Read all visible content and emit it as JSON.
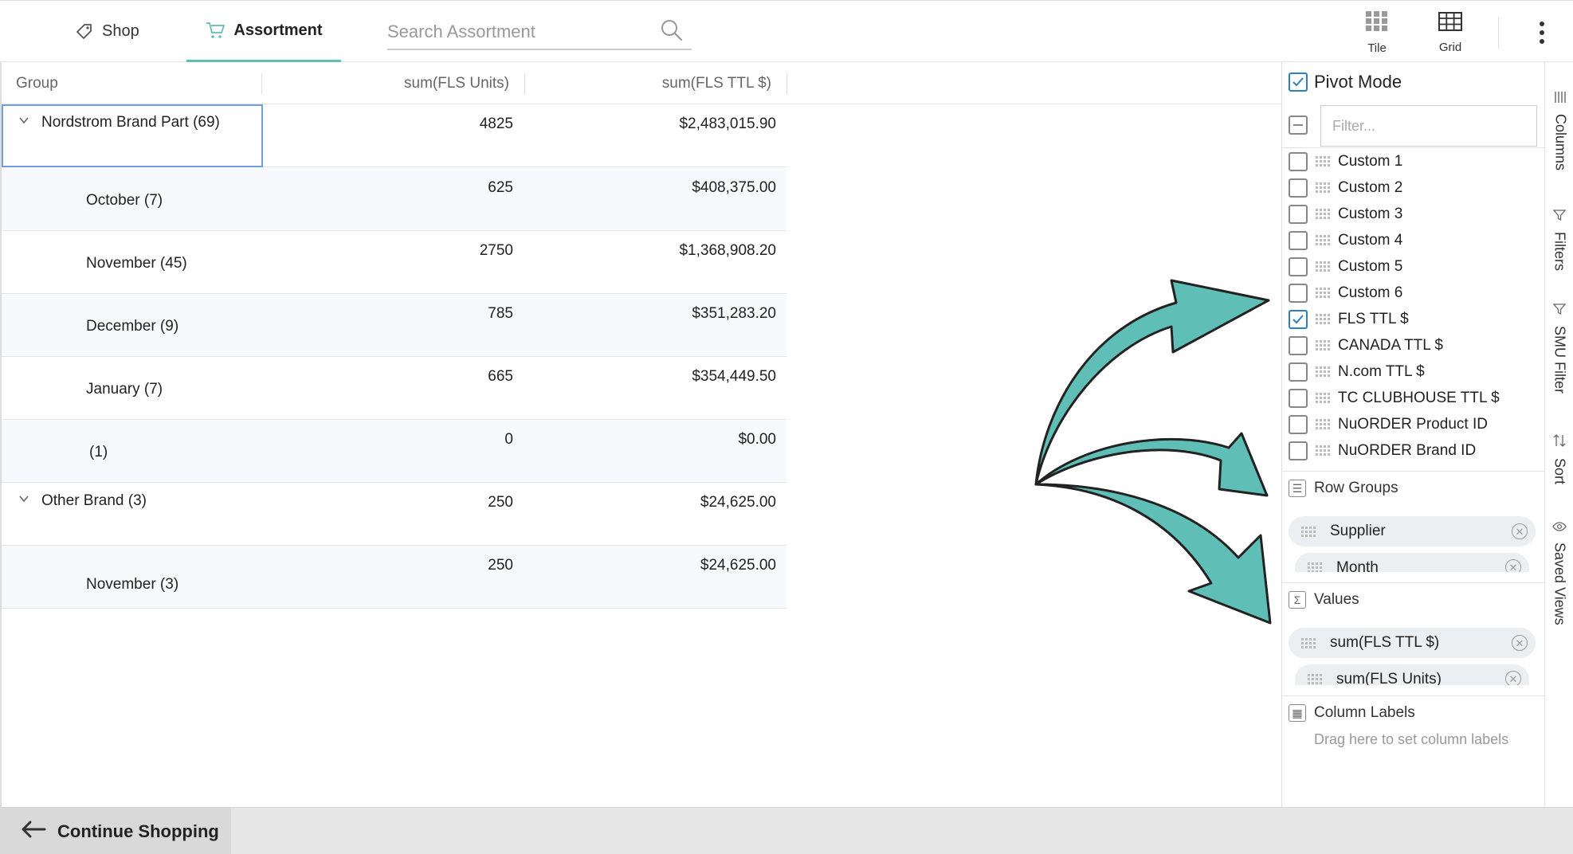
{
  "topbar": {
    "tabs": [
      {
        "label": "Shop",
        "icon": "tag-icon",
        "active": false
      },
      {
        "label": "Assortment",
        "icon": "cart-icon",
        "active": true
      }
    ],
    "search_placeholder": "Search Assortment",
    "views": [
      {
        "label": "Tile",
        "icon": "tile-icon"
      },
      {
        "label": "Grid",
        "icon": "grid-icon"
      }
    ],
    "accent_color": "#5fbfb6"
  },
  "grid": {
    "columns": [
      "Group",
      "sum(FLS Units)",
      "sum(FLS TTL $)"
    ],
    "rows": [
      {
        "label": "Nordstrom Brand Part (69)",
        "units": "4825",
        "ttl": "$2,483,015.90",
        "level": 0,
        "expanded": true
      },
      {
        "label": "October (7)",
        "units": "625",
        "ttl": "$408,375.00",
        "level": 1
      },
      {
        "label": "November (45)",
        "units": "2750",
        "ttl": "$1,368,908.20",
        "level": 1
      },
      {
        "label": "December (9)",
        "units": "785",
        "ttl": "$351,283.20",
        "level": 1
      },
      {
        "label": "January (7)",
        "units": "665",
        "ttl": "$354,449.50",
        "level": 1
      },
      {
        "label": "(1)",
        "units": "0",
        "ttl": "$0.00",
        "level": 1
      },
      {
        "label": "Other Brand (3)",
        "units": "250",
        "ttl": "$24,625.00",
        "level": 0,
        "expanded": true
      },
      {
        "label": "November (3)",
        "units": "250",
        "ttl": "$24,625.00",
        "level": 1
      }
    ]
  },
  "panel": {
    "pivot_mode_label": "Pivot Mode",
    "pivot_mode_checked": true,
    "filter_placeholder": "Filter...",
    "column_items": [
      {
        "label": "Custom 1",
        "checked": false
      },
      {
        "label": "Custom 2",
        "checked": false
      },
      {
        "label": "Custom 3",
        "checked": false
      },
      {
        "label": "Custom 4",
        "checked": false
      },
      {
        "label": "Custom 5",
        "checked": false
      },
      {
        "label": "Custom 6",
        "checked": false
      },
      {
        "label": "FLS TTL $",
        "checked": true
      },
      {
        "label": "CANADA TTL $",
        "checked": false
      },
      {
        "label": "N.com TTL $",
        "checked": false
      },
      {
        "label": "TC CLUBHOUSE TTL $",
        "checked": false
      },
      {
        "label": "NuORDER Product ID",
        "checked": false
      },
      {
        "label": "NuORDER Brand ID",
        "checked": false
      }
    ],
    "row_groups": {
      "title": "Row Groups",
      "items": [
        "Supplier",
        "Month"
      ]
    },
    "values": {
      "title": "Values",
      "items": [
        "sum(FLS TTL $)",
        "sum(FLS Units)"
      ]
    },
    "column_labels": {
      "title": "Column Labels",
      "hint": "Drag here to set column labels"
    }
  },
  "side_tabs": [
    "Columns",
    "Filters",
    "SMU Filter",
    "Sort",
    "Saved Views"
  ],
  "bottombar": {
    "continue_label": "Continue Shopping"
  },
  "annotation": {
    "arrow_color": "#5fbfb6"
  }
}
